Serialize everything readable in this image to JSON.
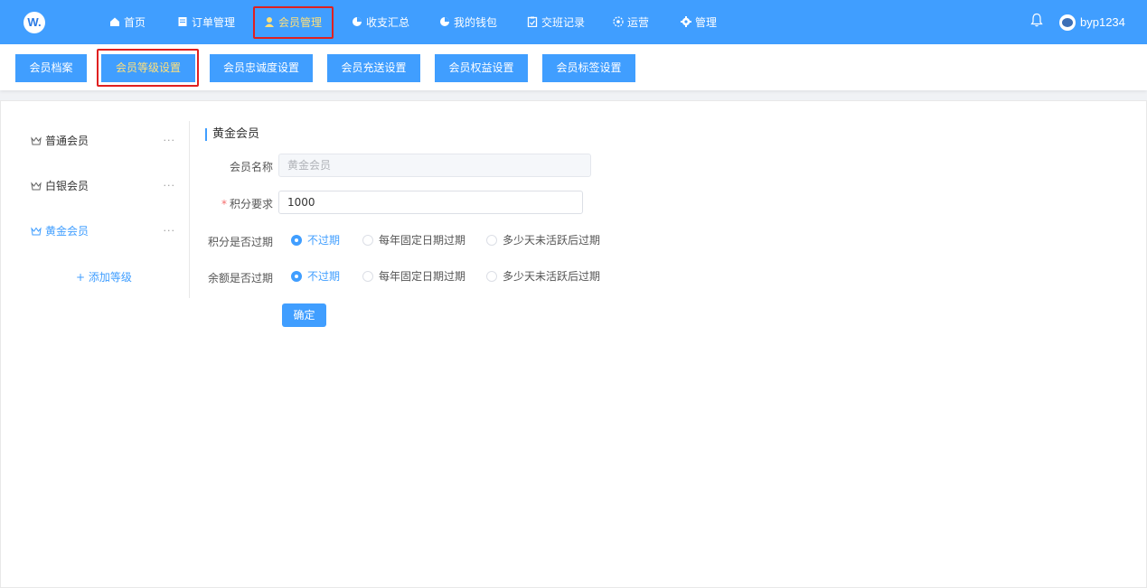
{
  "header": {
    "logo_text": "W.",
    "nav": [
      {
        "label": "首页",
        "icon": "home-icon"
      },
      {
        "label": "订单管理",
        "icon": "document-icon"
      },
      {
        "label": "会员管理",
        "icon": "user-icon"
      },
      {
        "label": "收支汇总",
        "icon": "pie-chart-icon"
      },
      {
        "label": "我的钱包",
        "icon": "pie-chart-icon"
      },
      {
        "label": "交班记录",
        "icon": "clipboard-icon"
      },
      {
        "label": "运营",
        "icon": "target-icon"
      },
      {
        "label": "管理",
        "icon": "gear-icon"
      }
    ],
    "active_nav": "会员管理",
    "username": "byp1234"
  },
  "subnav": {
    "tabs": [
      "会员档案",
      "会员等级设置",
      "会员忠诚度设置",
      "会员充送设置",
      "会员权益设置",
      "会员标签设置"
    ],
    "active_tab": "会员等级设置"
  },
  "levels": {
    "items": [
      "普通会员",
      "白银会员",
      "黄金会员"
    ],
    "more": "···",
    "active": "黄金会员",
    "add_label": "+ 添加等级"
  },
  "form": {
    "title": "黄金会员",
    "name_label": "会员名称",
    "name_placeholder": "黄金会员",
    "points_label": "积分要求",
    "points_required_mark": "*",
    "points_value": "1000",
    "points_expire_label": "积分是否过期",
    "balance_expire_label": "余额是否过期",
    "expire_options": [
      "不过期",
      "每年固定日期过期",
      "多少天未活跃后过期"
    ],
    "points_expire_selected": "不过期",
    "balance_expire_selected": "不过期",
    "confirm_label": "确定"
  },
  "colors": {
    "primary": "#409eff",
    "active_text": "#ffe07a",
    "highlight_box": "#e02020"
  }
}
